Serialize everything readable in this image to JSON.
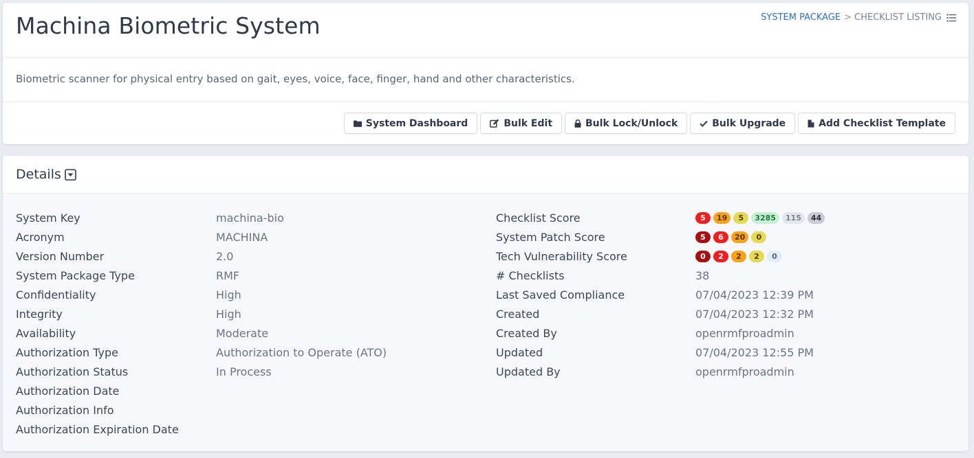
{
  "header": {
    "title": "Machina Biometric System",
    "breadcrumb": {
      "link_label": "SYSTEM PACKAGE",
      "separator": ">",
      "current_label": "CHECKLIST LISTING"
    },
    "description": "Biometric scanner for physical entry based on gait, eyes, voice, face, finger, hand and other characteristics."
  },
  "toolbar": {
    "system_dashboard_label": "System Dashboard",
    "bulk_edit_label": "Bulk Edit",
    "bulk_lock_label": "Bulk Lock/Unlock",
    "bulk_upgrade_label": "Bulk Upgrade",
    "add_template_label": "Add Checklist Template"
  },
  "details": {
    "title": "Details",
    "left": [
      {
        "label": "System Key",
        "value": "machina-bio"
      },
      {
        "label": "Acronym",
        "value": "MACHINA"
      },
      {
        "label": "Version Number",
        "value": "2.0"
      },
      {
        "label": "System Package Type",
        "value": "RMF"
      },
      {
        "label": "Confidentiality",
        "value": "High"
      },
      {
        "label": "Integrity",
        "value": "High"
      },
      {
        "label": "Availability",
        "value": "Moderate"
      },
      {
        "label": "Authorization Type",
        "value": "Authorization to Operate (ATO)"
      },
      {
        "label": "Authorization Status",
        "value": "In Process"
      },
      {
        "label": "Authorization Date",
        "value": ""
      },
      {
        "label": "Authorization Info",
        "value": ""
      },
      {
        "label": "Authorization Expiration Date",
        "value": ""
      }
    ],
    "right": [
      {
        "label": "Checklist Score",
        "badges": [
          {
            "value": "5",
            "bg": "#f01f1f",
            "fg": "#ffffff"
          },
          {
            "value": "19",
            "bg": "#f7a21b",
            "fg": "#5a3300"
          },
          {
            "value": "5",
            "bg": "#e6da55",
            "fg": "#4a4400"
          },
          {
            "value": "3285",
            "bg": "#c8f0d5",
            "fg": "#1f7a3f"
          },
          {
            "value": "115",
            "bg": "#e3e6ea",
            "fg": "#7a8391"
          },
          {
            "value": "44",
            "bg": "#c8ccd2",
            "fg": "#2a2f36"
          }
        ]
      },
      {
        "label": "System Patch Score",
        "badges": [
          {
            "value": "5",
            "bg": "#a51212",
            "fg": "#ffffff"
          },
          {
            "value": "6",
            "bg": "#f01f1f",
            "fg": "#ffffff"
          },
          {
            "value": "20",
            "bg": "#f7a21b",
            "fg": "#5a3300"
          },
          {
            "value": "0",
            "bg": "#e6da55",
            "fg": "#4a4400"
          }
        ]
      },
      {
        "label": "Tech Vulnerability Score",
        "badges": [
          {
            "value": "0",
            "bg": "#a51212",
            "fg": "#ffffff"
          },
          {
            "value": "2",
            "bg": "#f01f1f",
            "fg": "#ffffff"
          },
          {
            "value": "2",
            "bg": "#f7a21b",
            "fg": "#5a3300"
          },
          {
            "value": "2",
            "bg": "#e6da55",
            "fg": "#4a4400"
          },
          {
            "value": "0",
            "bg": "#e4ecf6",
            "fg": "#5a6577"
          }
        ]
      },
      {
        "label": "# Checklists",
        "value": "38"
      },
      {
        "label": "Last Saved Compliance",
        "value": "07/04/2023 12:39 PM"
      },
      {
        "label": "Created",
        "value": "07/04/2023 12:32 PM"
      },
      {
        "label": "Created By",
        "value": "openrmfproadmin"
      },
      {
        "label": "Updated",
        "value": "07/04/2023 12:55 PM"
      },
      {
        "label": "Updated By",
        "value": "openrmfproadmin"
      }
    ]
  }
}
